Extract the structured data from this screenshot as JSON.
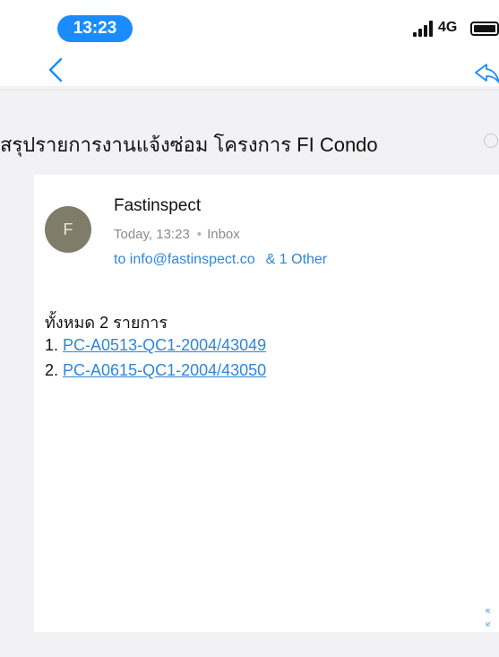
{
  "status_bar": {
    "time": "13:23",
    "network": "4G",
    "time_pill_color": "#1a8cff"
  },
  "nav": {
    "back_icon": "chevron-left-icon",
    "reply_icon": "reply-icon",
    "accent_color": "#1a8cff"
  },
  "subject": {
    "text": "สรุปรายการงานแจ้งซ่อม โครงการ FI Condo"
  },
  "email": {
    "avatar_initial": "F",
    "sender": "Fastinspect",
    "date": "Today, 13:23",
    "separator": "•",
    "folder": "Inbox",
    "recipient": "to info@fastinspect.co",
    "others": "& 1 Other",
    "body": {
      "heading": "ทั้งหมด 2 รายการ",
      "items": [
        {
          "number": "1.",
          "link": "PC-A0513-QC1-2004/43049"
        },
        {
          "number": "2.",
          "link": "PC-A0615-QC1-2004/43050"
        }
      ]
    },
    "link_color": "#2e86d9"
  }
}
